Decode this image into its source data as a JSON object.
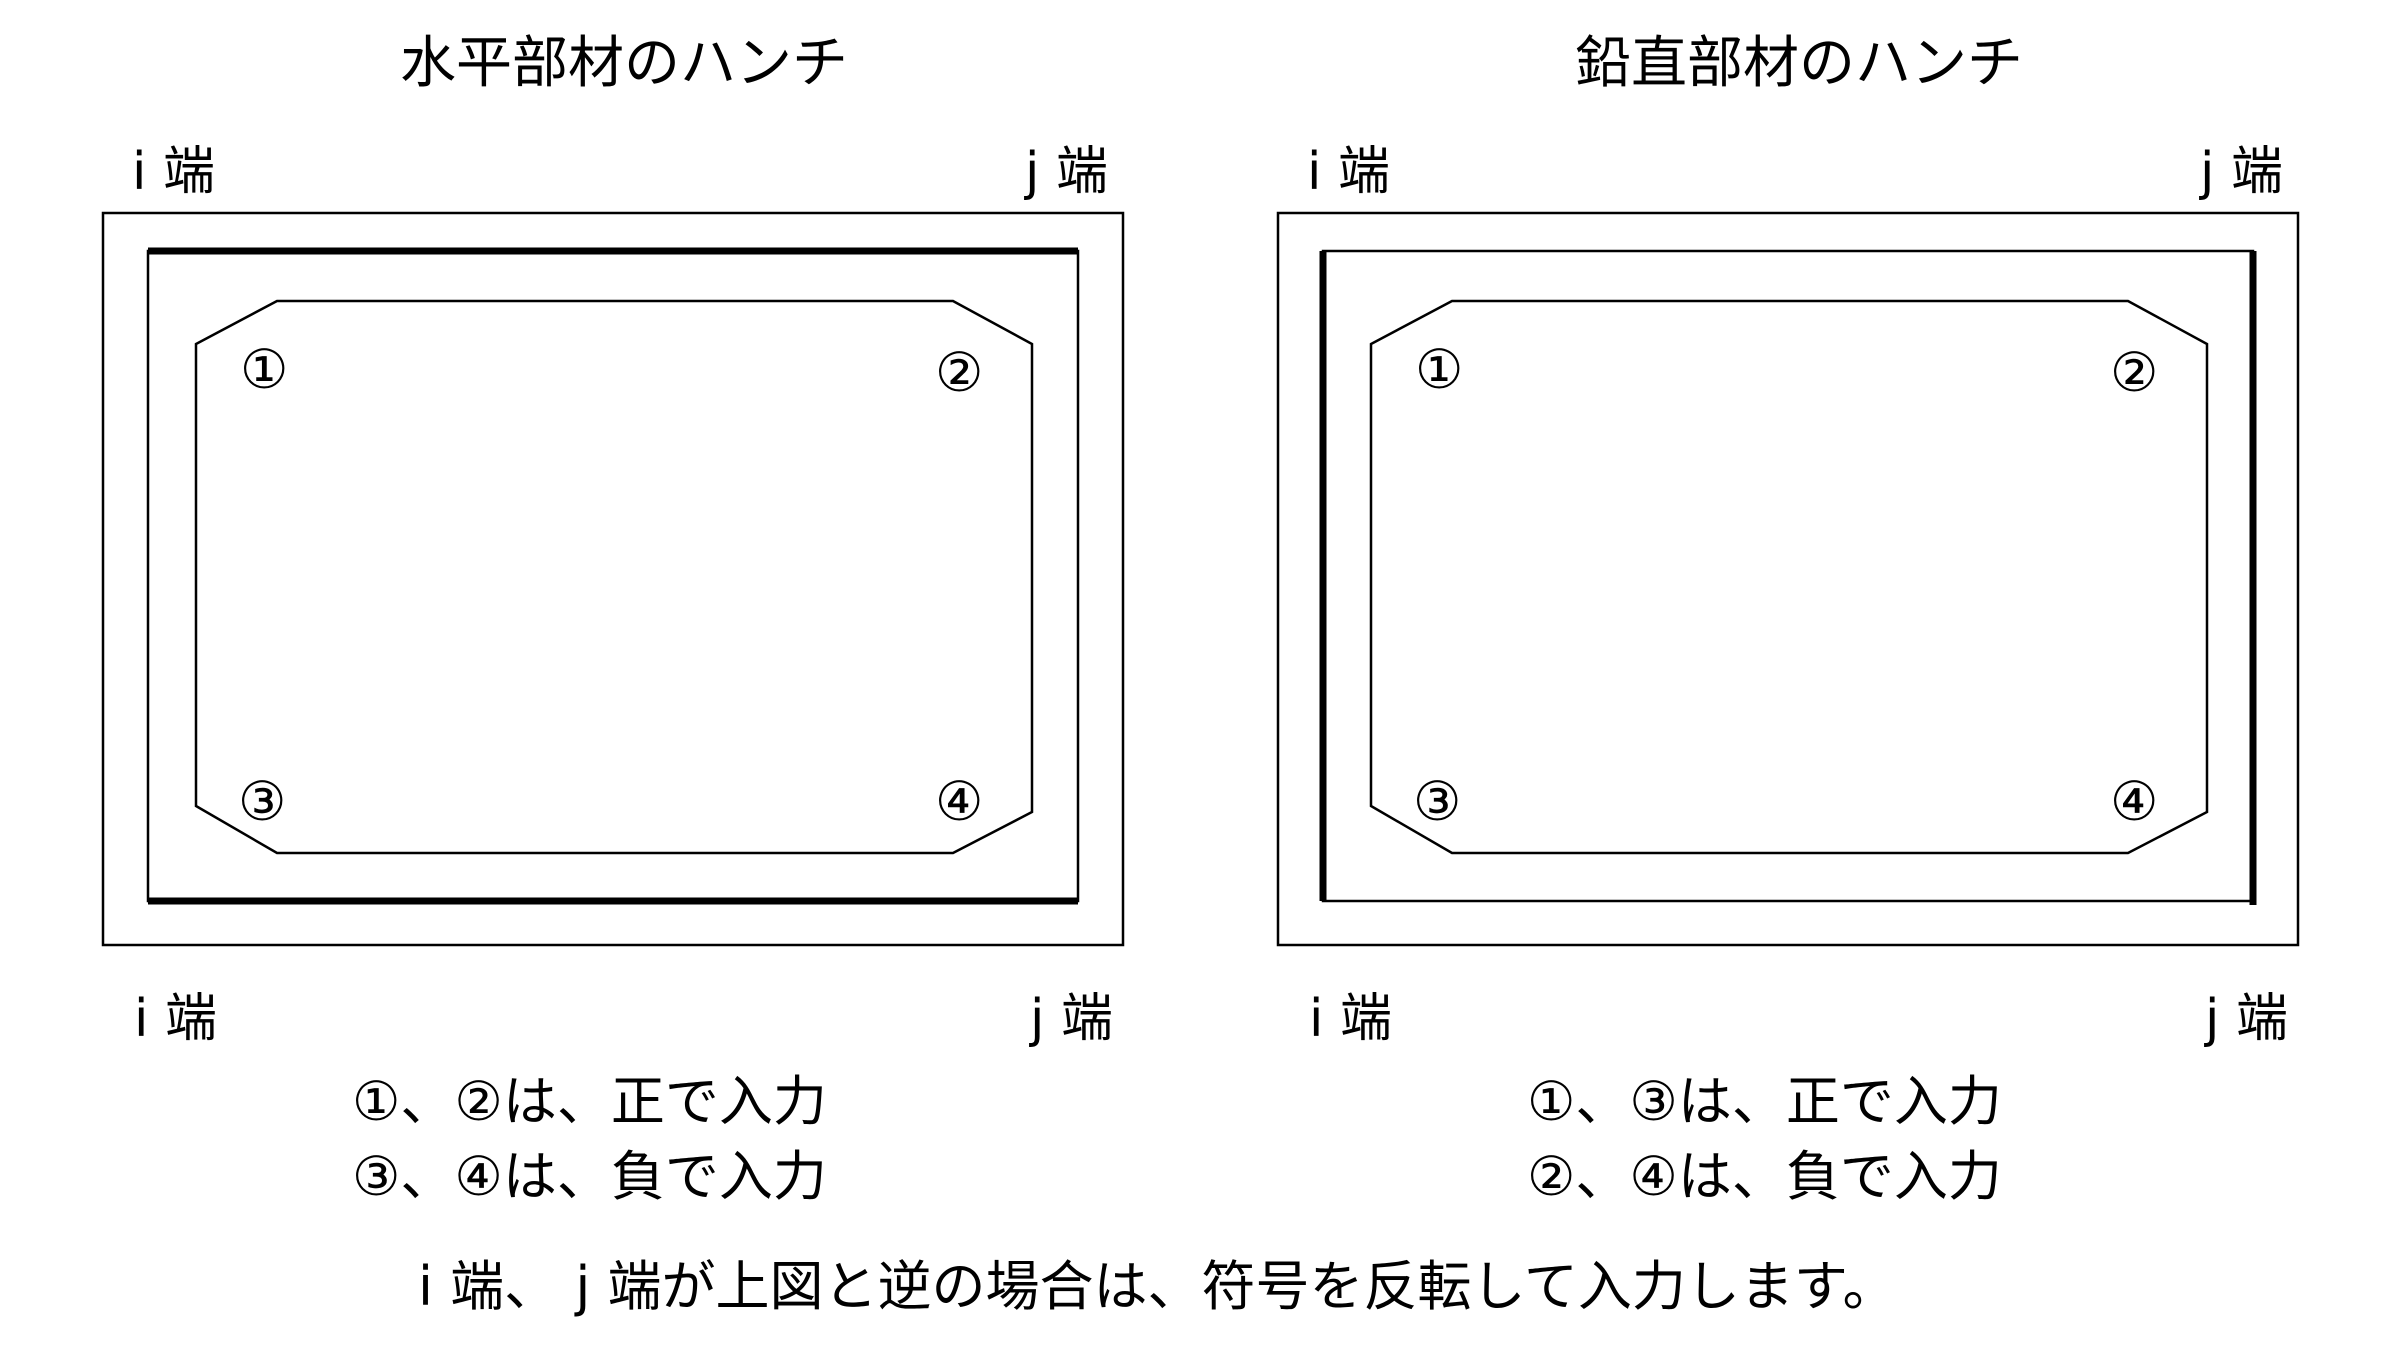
{
  "left_panel": {
    "title": "水平部材のハンチ",
    "top_i": "i 端",
    "top_j": "j 端",
    "bottom_i": "i 端",
    "bottom_j": "j 端",
    "corners": [
      "①",
      "②",
      "③",
      "④"
    ],
    "note_line1": "①、②は、正で入力",
    "note_line2": "③、④は、負で入力"
  },
  "right_panel": {
    "title": "鉛直部材のハンチ",
    "top_i": "i 端",
    "top_j": "j 端",
    "bottom_i": "i 端",
    "bottom_j": "j 端",
    "corners": [
      "①",
      "②",
      "③",
      "④"
    ],
    "note_line1": "①、③は、正で入力",
    "note_line2": "②、④は、負で入力"
  },
  "footer": "i 端、 j 端が上図と逆の場合は、符号を反転して入力します。"
}
